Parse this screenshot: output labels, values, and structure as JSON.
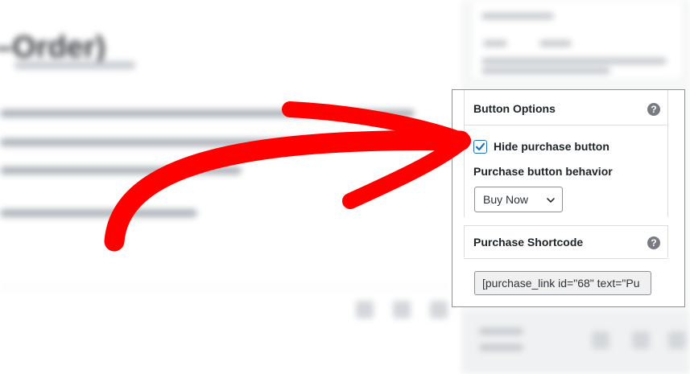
{
  "panel": {
    "button_options": {
      "title": "Button Options",
      "help_icon": "question-circle-icon",
      "hide_purchase_label": "Hide purchase button",
      "hide_purchase_checked": true,
      "behavior_label": "Purchase button behavior",
      "behavior_selected": "Buy Now"
    },
    "purchase_shortcode": {
      "title": "Purchase Shortcode",
      "help_icon": "question-circle-icon",
      "value": "[purchase_link id=\"68\" text=\"Pu"
    }
  },
  "colors": {
    "accent": "#2271b1",
    "arrow": "#ff0000"
  }
}
